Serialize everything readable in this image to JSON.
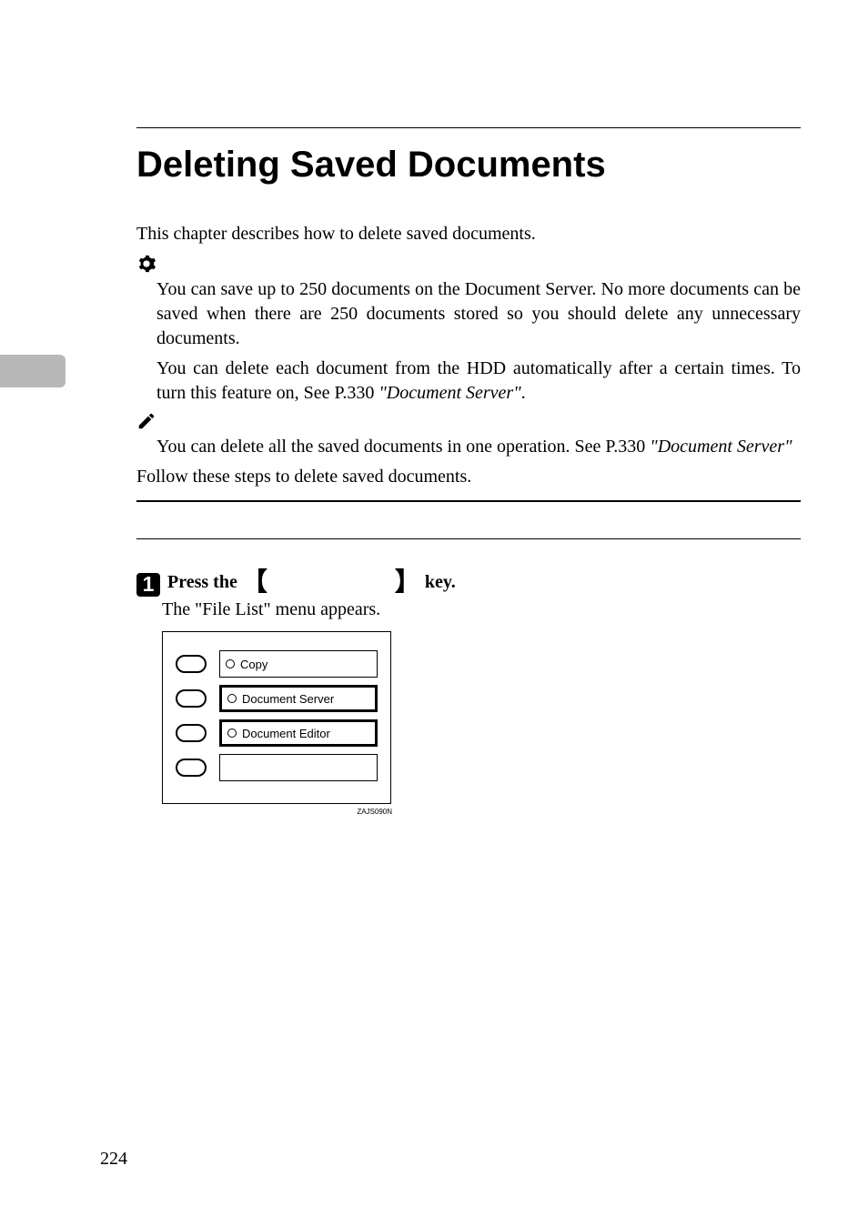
{
  "title": "Deleting Saved Documents",
  "intro": "This chapter describes how to delete saved documents.",
  "important": {
    "para1": "You can save up to 250 documents on the Document Server. No more documents can be saved when there are 250 documents stored so you should delete any unnecessary documents.",
    "para2_a": "You can delete each document from the HDD automatically after a certain times. To turn this feature on, See ",
    "para2_b": "P.330 ",
    "para2_c": "\"Document Server\"",
    "para2_d": "."
  },
  "note": {
    "para_a": "You can delete all the saved documents in one operation. See ",
    "para_b": "P.330 ",
    "para_c": "\"Document Server\""
  },
  "follow": "Follow these steps to delete saved documents.",
  "step": {
    "badge": "1",
    "text_a": "Press the ",
    "text_b": " key.",
    "sub": "The \"File List\" menu appears."
  },
  "panel": {
    "row1": "Copy",
    "row2": "Document Server",
    "row3": "Document Editor"
  },
  "fig_caption": "ZAJS090N",
  "page_number": "224"
}
